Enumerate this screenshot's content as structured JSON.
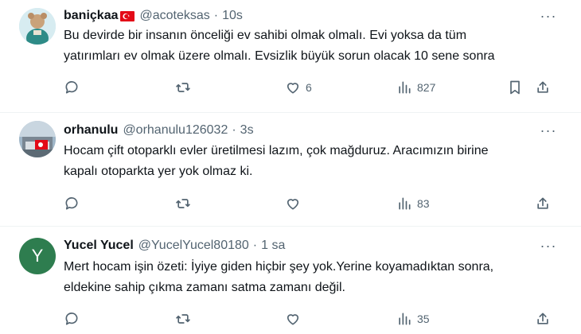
{
  "tweets": [
    {
      "name": "baniçkaa",
      "handle": "@acoteksas",
      "time": "10s",
      "text_lines": [
        "Bu devirde bir insanın önceliği ev sahibi olmak olmalı. Evi yoksa da tüm",
        "yatırımları ev olmak üzere olmalı. Evsizlik büyük sorun olacak 10 sene sonra"
      ],
      "likes": "6",
      "views": "827"
    },
    {
      "name": "orhanulu",
      "handle": "@orhanulu126032",
      "time": "3s",
      "text_lines": [
        "Hocam çift otoparklı evler üretilmesi lazım, çok mağduruz. Aracımızın birine",
        "kapalı otoparkta yer yok olmaz ki."
      ],
      "likes": "",
      "views": "83"
    },
    {
      "name": "Yucel Yucel",
      "handle": "@YucelYucel80180",
      "time": "1 sa",
      "avatar_letter": "Y",
      "text_lines": [
        "Mert hocam işin özeti: İyiye giden hiçbir şey yok.Yerine koyamadıktan sonra,",
        "eldekine sahip çıkma zamanı satma zamanı değil."
      ],
      "likes": "",
      "views": "35"
    }
  ],
  "separator": "·",
  "more_glyph": "···",
  "colors": {
    "text": "#0f1419",
    "secondary": "#536471",
    "divider": "#eff3f4",
    "avatar_green": "#2e7d4f",
    "flag_red": "#e30a17"
  },
  "icons": [
    "reply-icon",
    "retweet-icon",
    "heart-icon",
    "views-icon",
    "bookmark-icon",
    "share-icon",
    "more-icon",
    "flag-icon"
  ]
}
